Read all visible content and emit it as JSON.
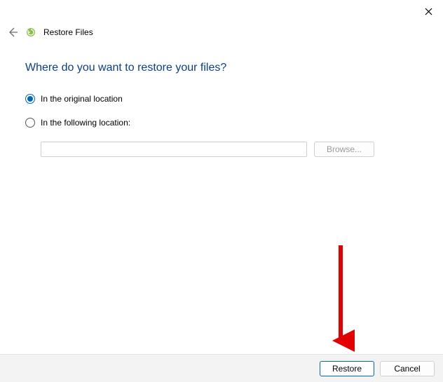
{
  "titlebar": {
    "close_icon": "✕"
  },
  "header": {
    "title": "Restore Files"
  },
  "main": {
    "heading": "Where do you want to restore your files?",
    "option_original": "In the original location",
    "option_following": "In the following location:",
    "path_value": "",
    "browse_label": "Browse..."
  },
  "footer": {
    "restore_label": "Restore",
    "cancel_label": "Cancel"
  }
}
